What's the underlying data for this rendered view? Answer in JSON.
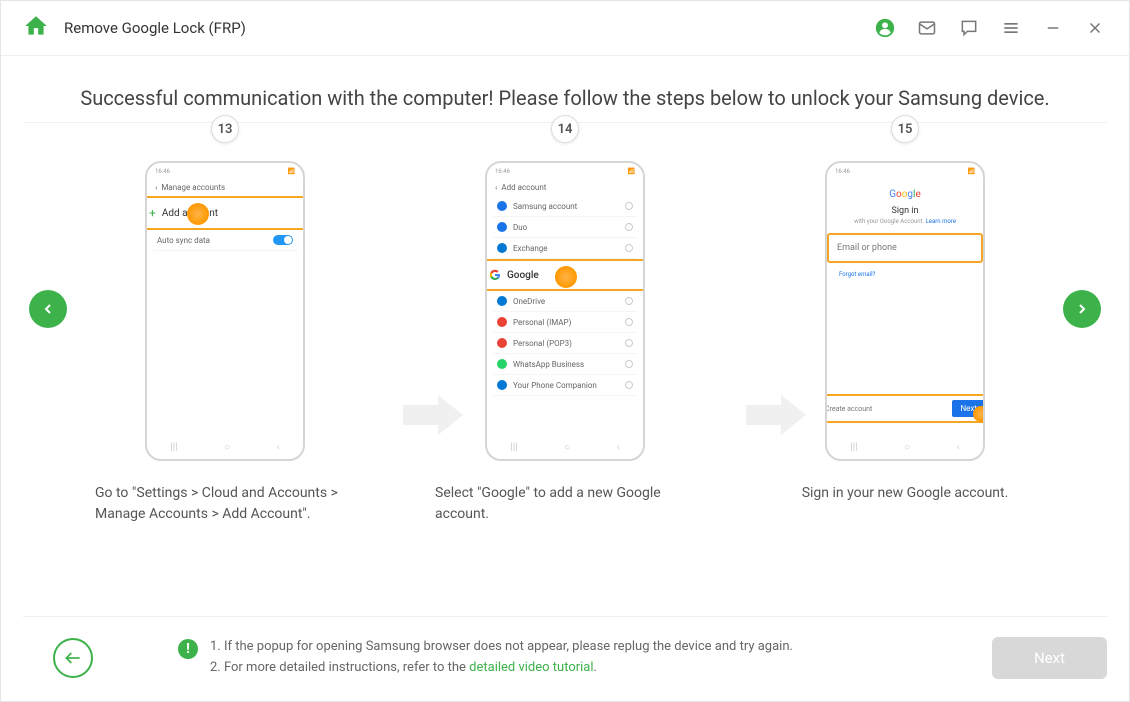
{
  "header": {
    "title": "Remove Google Lock (FRP)"
  },
  "main": {
    "headline": "Successful communication with the computer! Please follow the steps below to unlock your Samsung device."
  },
  "steps": [
    {
      "number": "13",
      "caption": "Go to \"Settings > Cloud and Accounts > Manage Accounts > Add Account\".",
      "phone": {
        "back_label": "Manage accounts",
        "highlight_label": "Add account",
        "auto_sync": "Auto sync data",
        "time": "16:46"
      }
    },
    {
      "number": "14",
      "caption": "Select \"Google\" to add a new Google account.",
      "phone": {
        "back_label": "Add account",
        "time": "16:46",
        "items": [
          "Samsung account",
          "Duo",
          "Exchange",
          "Google",
          "OneDrive",
          "Personal (IMAP)",
          "Personal (POP3)",
          "WhatsApp Business",
          "Your Phone Companion"
        ]
      }
    },
    {
      "number": "15",
      "caption": "Sign in your new Google account.",
      "phone": {
        "time": "16:46",
        "signin_title": "Sign in",
        "signin_sub": "with your Google Account.",
        "learn_more": "Learn more",
        "email_placeholder": "Email or phone",
        "forgot": "Forgot email?",
        "create": "Create account",
        "next_btn": "Next"
      }
    }
  ],
  "tips": {
    "line1": "1. If the popup for opening Samsung browser does not appear, please replug the device and try again.",
    "line2_prefix": "2. For more detailed instructions, refer to the ",
    "line2_link": "detailed video tutorial",
    "line2_suffix": "."
  },
  "footer": {
    "next_label": "Next"
  }
}
